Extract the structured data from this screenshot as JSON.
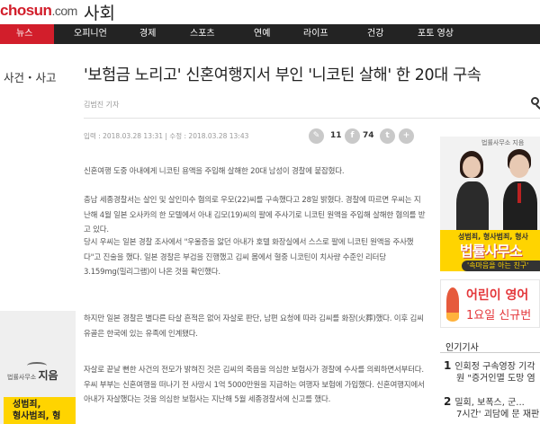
{
  "header": {
    "logo_main": "chosun",
    "logo_suffix": ".com",
    "section": "사회"
  },
  "nav": {
    "items": [
      {
        "label": "뉴스",
        "active": true
      },
      {
        "label": "오피니언"
      },
      {
        "label": "경제"
      },
      {
        "label": "스포츠"
      },
      {
        "label": "연예"
      },
      {
        "label": "라이프"
      },
      {
        "label": "건강"
      },
      {
        "label": "포토 영상"
      }
    ]
  },
  "article": {
    "breadcrumb": "사건・사고",
    "headline": "'보험금 노리고' 신혼여행지서 부인 '니코틴 살해' 한 20대 구속",
    "byline": "김범진 기자",
    "dates": "입력 : 2018.03.28 13:31  |  수정 : 2018.03.28 13:43",
    "share": {
      "comment_count": "11",
      "like_count": "74"
    },
    "paragraphs": [
      "신혼여행 도중 아내에게 니코틴 용액을 주입해 살해한 20대 남성이 경찰에 붙잡혔다.",
      "충남 세종경찰서는 살인 및 살인미수 혐의로 우모(22)씨를 구속했다고 28일 밝혔다. 경찰에 따르면 우씨는 지난해 4월 일본 오사카의 한 모텔에서 아내 김모(19)씨의 팔에 주사기로 니코틴 원액을 주입해 살해한 혐의를 받고 있다.",
      "당시 우씨는 일본 경찰 조사에서 \"우울증을 앓던 아내가 호텔 화장실에서 스스로 팔에 니코틴 원액을 주사했다\"고 진술을 했다. 일본 경찰은 부검을 진행했고 김씨 몸에서 혈중 니코틴이 치사량 수준인 리터당 3.159mg(밀리그램)이 나온 것을 확인했다.",
      "하지만 일본 경찰은 별다른 타살 흔적은 없어 자살로 판단, 남편 요청에 따라 김씨를 화장(火葬)했다. 이후 김씨 유골은 한국에 있는 유족에 인계됐다.",
      "자살로 끝날 뻔한 사건의 전모가 밝혀진 것은 김씨의 죽음을 의심한 보험사가 경찰에 수사를 의뢰하면서부터다. 우씨 부부는 신혼여행을 떠나기 전 사망시 1억 5000만원을 지급하는 여행자 보험에 가입했다. 신혼여행지에서 아내가 자살했다는 것을 의심한 보험사는 지난해 5월 세종경찰서에 신고를 했다."
    ]
  },
  "ads": {
    "left": {
      "firm_small": "법률사무소",
      "firm_big": "지음",
      "yellow_text": "성범죄,\n형사범죄, 형"
    },
    "right_top": {
      "firm": "법률사무소 지음",
      "subtitle": "성범죄, 형사범죄, 형사",
      "title": "법률사무소",
      "pill": "'속마음을 아는 친구'"
    },
    "right_bottom": {
      "line1": "어린이 영어",
      "line2": "1요일 신규번"
    }
  },
  "popular": {
    "title": "인기기사",
    "items": [
      {
        "num": "1",
        "line1": "인회정 구속영장 기각",
        "line2": "원 \"증거인멸 도망 염"
      },
      {
        "num": "2",
        "line1": "밀회, 보폭스, 군...",
        "line2": "7시간' 괴담에 문 재판"
      }
    ]
  }
}
